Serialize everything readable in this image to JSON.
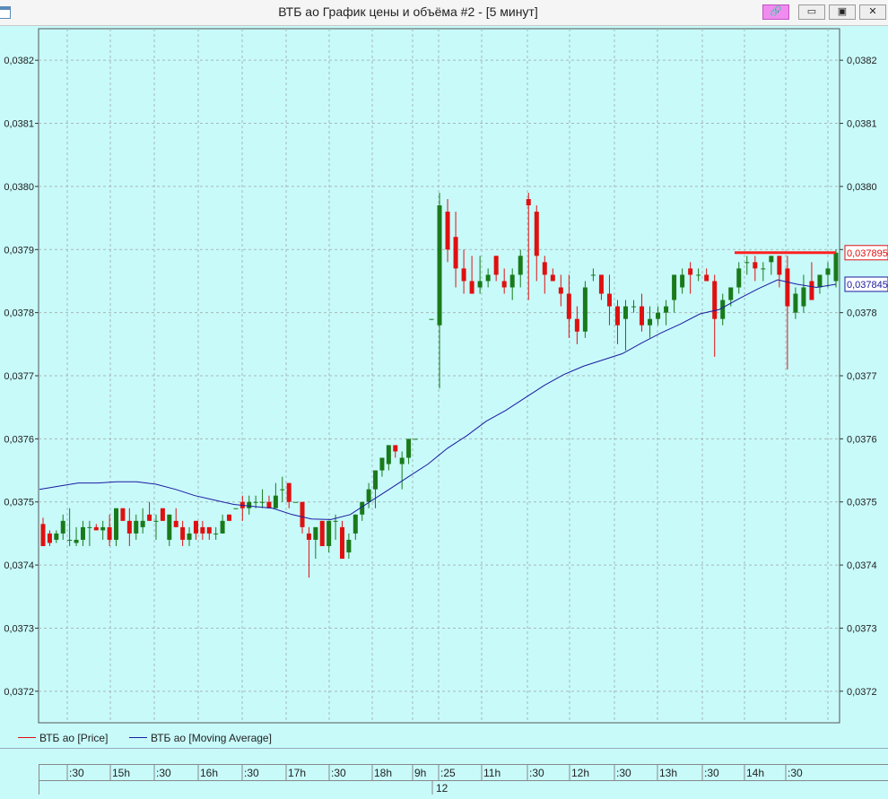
{
  "window": {
    "title": "ВТБ ао График цены и объёма #2 - [5 минут]",
    "buttons": {
      "link": "🔗",
      "minimize": "▭",
      "maximize": "▣",
      "close": "✕"
    }
  },
  "colors": {
    "background": "#c8fafa",
    "bull": "#1a7a1a",
    "bear": "#e01010",
    "ma": "#1a1aa0",
    "level": "#ff2020",
    "grid": "#a8b8b8"
  },
  "legend": [
    {
      "label": "ВТБ ао [Price]",
      "color": "#e01010"
    },
    {
      "label": "ВТБ ао [Moving Average]",
      "color": "#1a1aa0"
    }
  ],
  "time_axis": {
    "labels": [
      ":30",
      "15h",
      ":30",
      "16h",
      ":30",
      "17h",
      ":30",
      "18h",
      "9h",
      ":25",
      "11h",
      ":30",
      "12h",
      ":30",
      "13h",
      ":30",
      "14h",
      ":30"
    ],
    "date": "12"
  },
  "chart_data": {
    "type": "candlestick",
    "ylim": [
      0.03715,
      0.03825
    ],
    "yticks": [
      "0,0372",
      "0,0373",
      "0,0374",
      "0,0375",
      "0,0376",
      "0,0377",
      "0,0378",
      "0,0379",
      "0,0380",
      "0,0381",
      "0,0382"
    ],
    "price_label": "0,037895",
    "ma_label": "0,037845",
    "level": 0.037895,
    "series": [
      {
        "name": "ВТБ ао [Price]",
        "ohlc": [
          [
            0.037465,
            0.037475,
            0.03743,
            0.03743
          ],
          [
            0.03745,
            0.037455,
            0.03743,
            0.037435
          ],
          [
            0.03744,
            0.037455,
            0.037435,
            0.03745
          ],
          [
            0.03745,
            0.03748,
            0.03744,
            0.03747
          ],
          [
            0.03744,
            0.03749,
            0.03743,
            0.03744
          ],
          [
            0.037435,
            0.03746,
            0.03743,
            0.03744
          ],
          [
            0.03744,
            0.03747,
            0.03743,
            0.03746
          ],
          [
            0.03746,
            0.03747,
            0.03743,
            0.03746
          ],
          [
            0.03746,
            0.037465,
            0.037455,
            0.037455
          ],
          [
            0.037455,
            0.03747,
            0.03744,
            0.03746
          ],
          [
            0.03746,
            0.03748,
            0.03743,
            0.03744
          ],
          [
            0.03744,
            0.03749,
            0.03743,
            0.03749
          ],
          [
            0.03749,
            0.03749,
            0.03747,
            0.03747
          ],
          [
            0.03747,
            0.03749,
            0.03743,
            0.03745
          ],
          [
            0.03745,
            0.03748,
            0.03744,
            0.03747
          ],
          [
            0.03746,
            0.03749,
            0.03745,
            0.03747
          ],
          [
            0.03748,
            0.0375,
            0.03747,
            0.03747
          ],
          [
            0.03747,
            0.03748,
            0.03744,
            0.03747
          ],
          [
            0.03749,
            0.03749,
            0.03747,
            0.03747
          ],
          [
            0.03744,
            0.03748,
            0.03743,
            0.03748
          ],
          [
            0.03747,
            0.03749,
            0.03746,
            0.03746
          ],
          [
            0.03746,
            0.03747,
            0.03743,
            0.03744
          ],
          [
            0.03744,
            0.03746,
            0.03743,
            0.03745
          ],
          [
            0.03747,
            0.03747,
            0.03744,
            0.03745
          ],
          [
            0.03746,
            0.03747,
            0.03744,
            0.03745
          ],
          [
            0.03746,
            0.03746,
            0.03744,
            0.03745
          ],
          [
            0.03745,
            0.03746,
            0.03744,
            0.03745
          ],
          [
            0.03745,
            0.03748,
            0.03745,
            0.03747
          ],
          [
            0.03748,
            0.03748,
            0.03747,
            0.03747
          ],
          [
            0.03749,
            0.03749,
            0.03749,
            0.03749
          ],
          [
            0.0375,
            0.03751,
            0.03747,
            0.03749
          ],
          [
            0.03749,
            0.03751,
            0.03748,
            0.0375
          ],
          [
            0.0375,
            0.03751,
            0.03749,
            0.0375
          ],
          [
            0.0375,
            0.03752,
            0.03749,
            0.0375
          ],
          [
            0.0375,
            0.03751,
            0.03749,
            0.03749
          ],
          [
            0.03749,
            0.03753,
            0.03749,
            0.03751
          ],
          [
            0.03752,
            0.03754,
            0.0375,
            0.03752
          ],
          [
            0.03753,
            0.03753,
            0.03749,
            0.0375
          ],
          [
            0.0375,
            0.0375,
            0.0375,
            0.0375
          ],
          [
            0.0375,
            0.0375,
            0.03745,
            0.03746
          ],
          [
            0.03745,
            0.03746,
            0.03738,
            0.03744
          ],
          [
            0.03744,
            0.03746,
            0.03741,
            0.03746
          ],
          [
            0.03747,
            0.03747,
            0.03743,
            0.03743
          ],
          [
            0.03743,
            0.03747,
            0.03742,
            0.03747
          ],
          [
            0.03747,
            0.03748,
            0.03744,
            0.03747
          ],
          [
            0.03746,
            0.03747,
            0.03741,
            0.03741
          ],
          [
            0.03742,
            0.03745,
            0.03741,
            0.03744
          ],
          [
            0.03745,
            0.03748,
            0.03744,
            0.03748
          ],
          [
            0.03748,
            0.0375,
            0.03747,
            0.0375
          ],
          [
            0.0375,
            0.03753,
            0.03749,
            0.03752
          ],
          [
            0.03752,
            0.03755,
            0.03749,
            0.03755
          ],
          [
            0.03755,
            0.03757,
            0.03754,
            0.03757
          ],
          [
            0.03756,
            0.03759,
            0.03755,
            0.03759
          ],
          [
            0.03759,
            0.03759,
            0.03757,
            0.03758
          ],
          [
            0.03756,
            0.03758,
            0.03752,
            0.03757
          ],
          [
            0.03757,
            0.0376,
            0.03756,
            0.0376
          ],
          [
            0.0376,
            0.0376,
            0.0376,
            0.0376
          ],
          [
            0.03779,
            0.03779,
            0.03779,
            0.03779
          ],
          [
            0.03778,
            0.03799,
            0.03768,
            0.03797
          ],
          [
            0.03796,
            0.03798,
            0.03788,
            0.0379
          ],
          [
            0.03792,
            0.03796,
            0.03784,
            0.03787
          ],
          [
            0.03787,
            0.0379,
            0.03783,
            0.03785
          ],
          [
            0.03785,
            0.03789,
            0.03783,
            0.03783
          ],
          [
            0.03784,
            0.03789,
            0.03783,
            0.03785
          ],
          [
            0.03785,
            0.03787,
            0.03784,
            0.03786
          ],
          [
            0.03789,
            0.03789,
            0.03785,
            0.03786
          ],
          [
            0.03785,
            0.03787,
            0.03783,
            0.03784
          ],
          [
            0.03784,
            0.03787,
            0.03782,
            0.03786
          ],
          [
            0.03786,
            0.0379,
            0.03784,
            0.03789
          ],
          [
            0.03798,
            0.03799,
            0.03782,
            0.03797
          ],
          [
            0.03796,
            0.03797,
            0.03785,
            0.03789
          ],
          [
            0.03788,
            0.03789,
            0.03783,
            0.03786
          ],
          [
            0.03786,
            0.03787,
            0.03785,
            0.03785
          ],
          [
            0.03784,
            0.03786,
            0.03781,
            0.03783
          ],
          [
            0.03783,
            0.03786,
            0.03776,
            0.03779
          ],
          [
            0.03779,
            0.03781,
            0.03775,
            0.03777
          ],
          [
            0.03777,
            0.03785,
            0.03776,
            0.03784
          ],
          [
            0.03786,
            0.03787,
            0.03785,
            0.03786
          ],
          [
            0.03786,
            0.03786,
            0.03782,
            0.03783
          ],
          [
            0.03783,
            0.03786,
            0.03778,
            0.03781
          ],
          [
            0.03781,
            0.03782,
            0.03775,
            0.03778
          ],
          [
            0.03779,
            0.03782,
            0.03774,
            0.03781
          ],
          [
            0.03781,
            0.03782,
            0.0378,
            0.03781
          ],
          [
            0.03781,
            0.03783,
            0.03777,
            0.03778
          ],
          [
            0.03778,
            0.03781,
            0.03776,
            0.03779
          ],
          [
            0.03779,
            0.03781,
            0.03778,
            0.0378
          ],
          [
            0.0378,
            0.03782,
            0.03778,
            0.03781
          ],
          [
            0.03782,
            0.03786,
            0.0378,
            0.03786
          ],
          [
            0.03784,
            0.03787,
            0.03783,
            0.03786
          ],
          [
            0.03787,
            0.03788,
            0.03783,
            0.03786
          ],
          [
            0.03786,
            0.03787,
            0.03785,
            0.03786
          ],
          [
            0.03786,
            0.03787,
            0.03785,
            0.03785
          ],
          [
            0.03785,
            0.03786,
            0.03773,
            0.03779
          ],
          [
            0.03779,
            0.03783,
            0.03778,
            0.03782
          ],
          [
            0.03782,
            0.03784,
            0.03781,
            0.03784
          ],
          [
            0.03784,
            0.03788,
            0.03783,
            0.03787
          ],
          [
            0.03788,
            0.03789,
            0.03786,
            0.03788
          ],
          [
            0.03788,
            0.03789,
            0.03785,
            0.03787
          ],
          [
            0.03787,
            0.03788,
            0.03785,
            0.03787
          ],
          [
            0.03788,
            0.03789,
            0.03786,
            0.03789
          ],
          [
            0.03789,
            0.03789,
            0.03784,
            0.03786
          ],
          [
            0.03787,
            0.03789,
            0.03771,
            0.03781
          ],
          [
            0.0378,
            0.03784,
            0.03779,
            0.03783
          ],
          [
            0.03781,
            0.03786,
            0.0378,
            0.03784
          ],
          [
            0.03785,
            0.03788,
            0.03784,
            0.03782
          ],
          [
            0.03784,
            0.03785,
            0.03783,
            0.03786
          ],
          [
            0.03786,
            0.03788,
            0.03784,
            0.03787
          ],
          [
            0.03785,
            0.0379,
            0.03784,
            0.037895
          ]
        ]
      },
      {
        "name": "ВТБ ао [Moving Average]",
        "values": [
          0.03752,
          0.037525,
          0.03753,
          0.03753,
          0.037532,
          0.037532,
          0.037528,
          0.03752,
          0.03751,
          0.037503,
          0.037496,
          0.037493,
          0.03749,
          0.03748,
          0.037473,
          0.037472,
          0.03748,
          0.0375,
          0.03752,
          0.03754,
          0.03756,
          0.037585,
          0.037605,
          0.037628,
          0.037645,
          0.037665,
          0.037685,
          0.037702,
          0.037715,
          0.037725,
          0.037735,
          0.037752,
          0.037768,
          0.037782,
          0.037798,
          0.037805,
          0.037822,
          0.037838,
          0.037852,
          0.037845,
          0.03784,
          0.037845
        ]
      }
    ]
  }
}
